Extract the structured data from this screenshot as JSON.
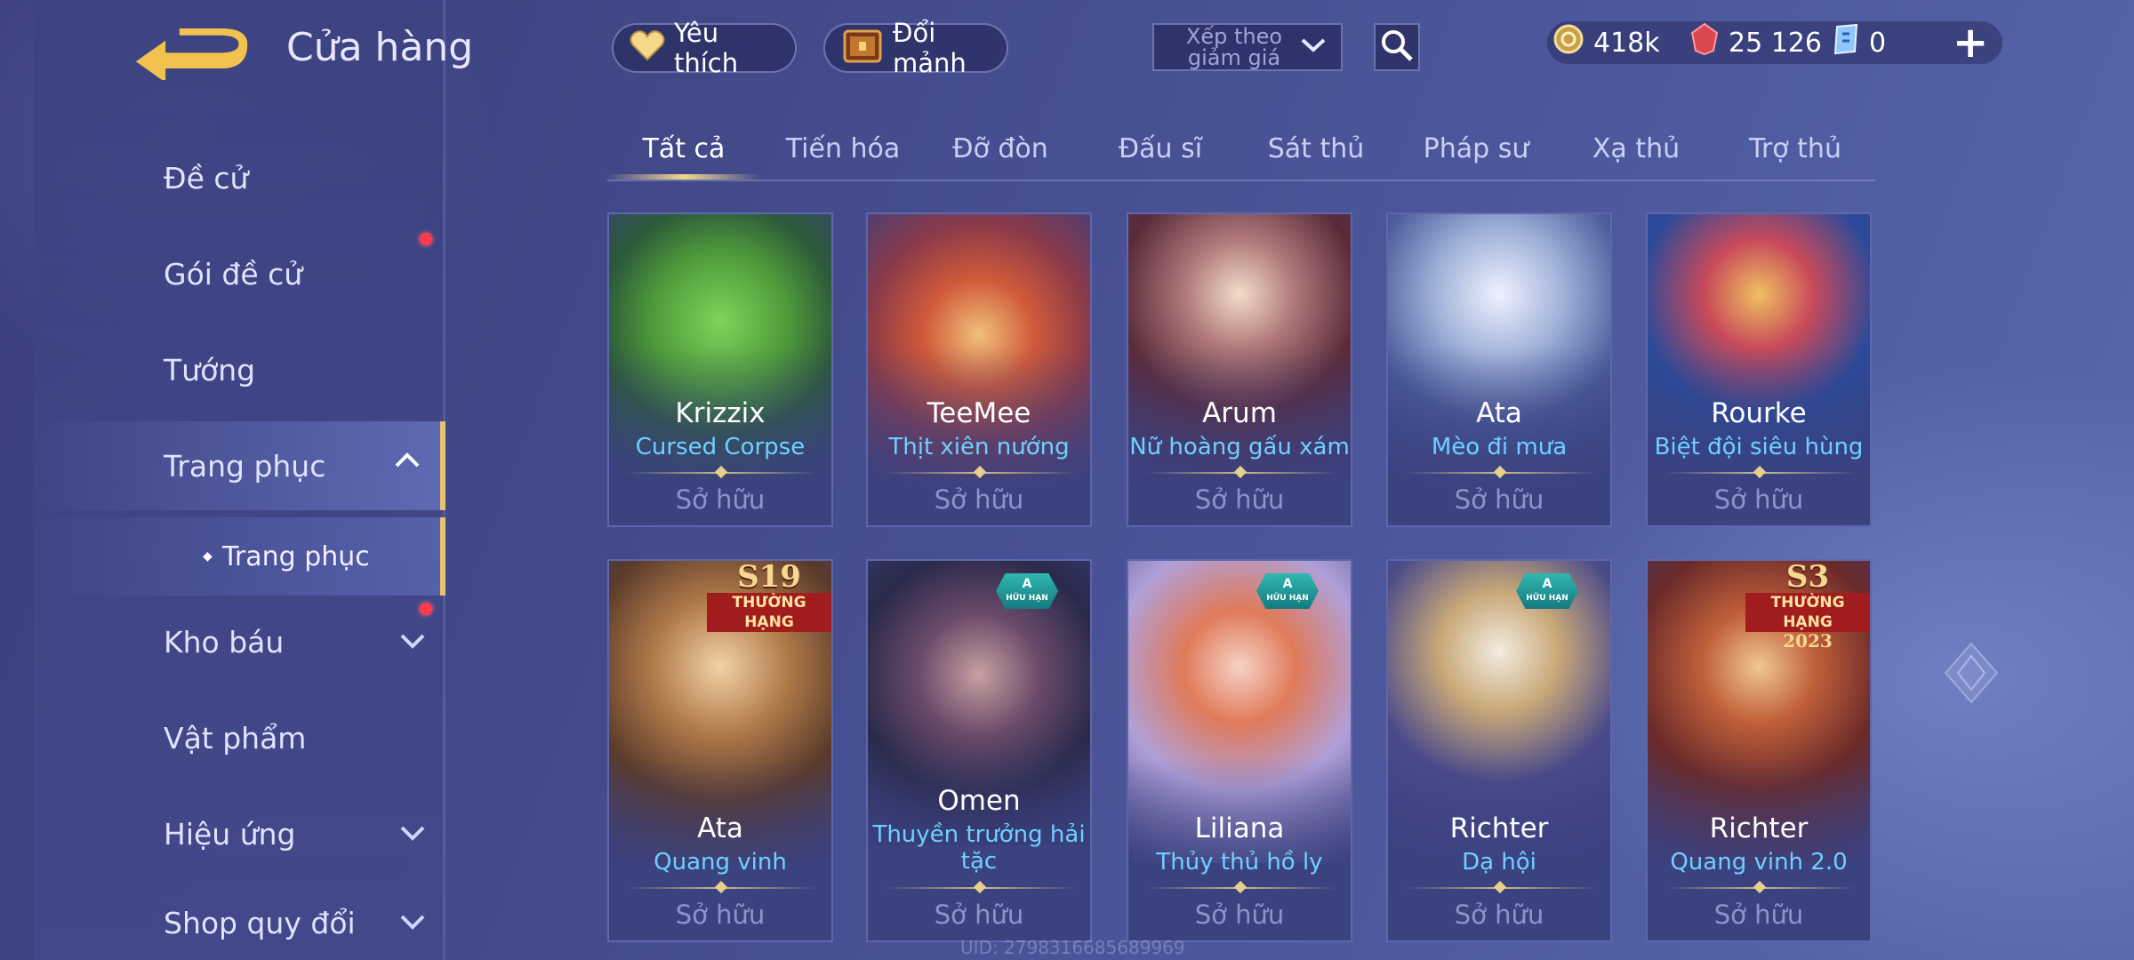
{
  "header": {
    "title": "Cửa hàng",
    "favorite_label": "Yêu thích",
    "exchange_label": "Đổi mảnh",
    "sort_placeholder": "Xếp theo giảm giá",
    "currencies": [
      {
        "icon": "gold-coin-icon",
        "value": "418k"
      },
      {
        "icon": "ruby-voucher-icon",
        "value": "25 126"
      },
      {
        "icon": "blue-ticket-icon",
        "value": "0"
      }
    ],
    "add_label": "+"
  },
  "sidebar": {
    "items": [
      {
        "label": "Đề cử"
      },
      {
        "label": "Gói đề cử"
      },
      {
        "label": "Tướng"
      },
      {
        "label": "Trang phục"
      },
      {
        "label": "Kho báu"
      },
      {
        "label": "Vật phẩm"
      },
      {
        "label": "Hiệu ứng"
      },
      {
        "label": "Shop quy đổi"
      }
    ],
    "submenu_label": "Trang phục"
  },
  "tabs": [
    "Tất cả",
    "Tiến hóa",
    "Đỡ đòn",
    "Đấu sĩ",
    "Sát thủ",
    "Pháp sư",
    "Xạ thủ",
    "Trợ thủ"
  ],
  "cards": [
    {
      "hero": "Krizzix",
      "skin": "Cursed Corpse",
      "status": "Sở hữu"
    },
    {
      "hero": "TeeMee",
      "skin": "Thịt xiên nướng",
      "status": "Sở hữu"
    },
    {
      "hero": "Arum",
      "skin": "Nữ hoàng gấu xám",
      "status": "Sở hữu"
    },
    {
      "hero": "Ata",
      "skin": "Mèo đi mưa",
      "status": "Sở hữu"
    },
    {
      "hero": "Rourke",
      "skin": "Biệt đội siêu hùng",
      "status": "Sở hữu"
    },
    {
      "hero": "Ata",
      "skin": "Quang vinh",
      "status": "Sở hữu",
      "badge_season": "S19",
      "badge_rank": "THƯỜNG HẠNG"
    },
    {
      "hero": "Omen",
      "skin_line1": "Thuyền trưởng hải",
      "skin_line2": "tặc",
      "status": "Sở hữu",
      "badge_limited": "A",
      "badge_limited_text": "HỮU HẠN"
    },
    {
      "hero": "Liliana",
      "skin": "Thủy thủ hồ ly",
      "status": "Sở hữu",
      "badge_limited": "A",
      "badge_limited_text": "HỮU HẠN"
    },
    {
      "hero": "Richter",
      "skin": "Dạ hội",
      "status": "Sở hữu",
      "badge_limited": "A",
      "badge_limited_text": "HỮU HẠN"
    },
    {
      "hero": "Richter",
      "skin": "Quang vinh 2.0",
      "status": "Sở hữu",
      "badge_season": "S3",
      "badge_rank": "THƯỜNG HẠNG",
      "badge_year": "2023"
    }
  ],
  "footer": {
    "uid": "UID: 2798316685689969"
  }
}
